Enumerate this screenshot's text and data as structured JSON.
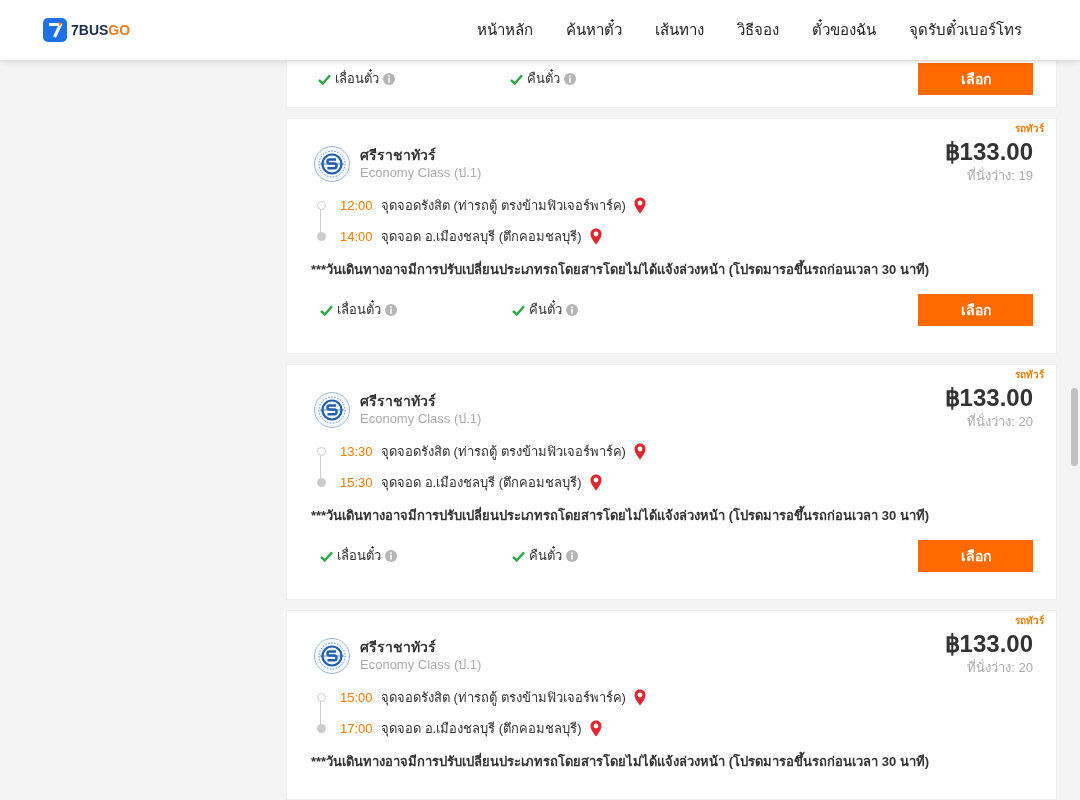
{
  "header": {
    "logo": {
      "part_1": "7BUS",
      "part_2": "GO"
    },
    "nav": [
      "หน้าหลัก",
      "ค้นหาตั๋ว",
      "เส้นทาง",
      "วิธีจอง",
      "ตั๋วของฉัน",
      "จุดรับตั๋วเบอร์โทร"
    ]
  },
  "cards": [
    {
      "options": [
        {
          "label": "เลื่อนตั๋ว",
          "available": true
        },
        {
          "label": "คืนตั๋ว",
          "available": true
        }
      ],
      "button": "เลือก"
    },
    {
      "badge": "รถทัวร์",
      "operator": "ศรีราชาทัวร์",
      "class": "Economy Class (ป.1)",
      "price": "฿133.00",
      "seats": "ที่นั่งว่าง: 19",
      "stops": [
        {
          "kind": "origin",
          "time": "12:00",
          "place": "จุดจอดรังสิต (ท่ารถตู้ ตรงข้ามฟิวเจอร์พาร์ค)"
        },
        {
          "kind": "destination",
          "time": "14:00",
          "place": "จุดจอด อ.เมืองชลบุรี (ตึกคอมชลบุรี)"
        }
      ],
      "notice": "***วันเดินทางอาจมีการปรับเปลี่ยนประเภทรถโดยสารโดยไม่ได้แจ้งล่วงหน้า (โปรดมารอขึ้นรถก่อนเวลา 30 นาที)",
      "options": [
        {
          "label": "เลื่อนตั๋ว",
          "available": true
        },
        {
          "label": "คืนตั๋ว",
          "available": true
        }
      ],
      "button": "เลือก"
    },
    {
      "badge": "รถทัวร์",
      "operator": "ศรีราชาทัวร์",
      "class": "Economy Class (ป.1)",
      "price": "฿133.00",
      "seats": "ที่นั่งว่าง: 20",
      "stops": [
        {
          "kind": "origin",
          "time": "13:30",
          "place": "จุดจอดรังสิต (ท่ารถตู้ ตรงข้ามฟิวเจอร์พาร์ค)"
        },
        {
          "kind": "destination",
          "time": "15:30",
          "place": "จุดจอด อ.เมืองชลบุรี (ตึกคอมชลบุรี)"
        }
      ],
      "notice": "***วันเดินทางอาจมีการปรับเปลี่ยนประเภทรถโดยสารโดยไม่ได้แจ้งล่วงหน้า (โปรดมารอขึ้นรถก่อนเวลา 30 นาที)",
      "options": [
        {
          "label": "เลื่อนตั๋ว",
          "available": true
        },
        {
          "label": "คืนตั๋ว",
          "available": true
        }
      ],
      "button": "เลือก"
    },
    {
      "badge": "รถทัวร์",
      "operator": "ศรีราชาทัวร์",
      "class": "Economy Class (ป.1)",
      "price": "฿133.00",
      "seats": "ที่นั่งว่าง: 20",
      "stops": [
        {
          "kind": "origin",
          "time": "15:00",
          "place": "จุดจอดรังสิต (ท่ารถตู้ ตรงข้ามฟิวเจอร์พาร์ค)"
        },
        {
          "kind": "destination",
          "time": "17:00",
          "place": "จุดจอด อ.เมืองชลบุรี (ตึกคอมชลบุรี)"
        }
      ],
      "notice": "***วันเดินทางอาจมีการปรับเปลี่ยนประเภทรถโดยสารโดยไม่ได้แจ้งล่วงหน้า (โปรดมารอขึ้นรถก่อนเวลา 30 นาที)"
    }
  ]
}
